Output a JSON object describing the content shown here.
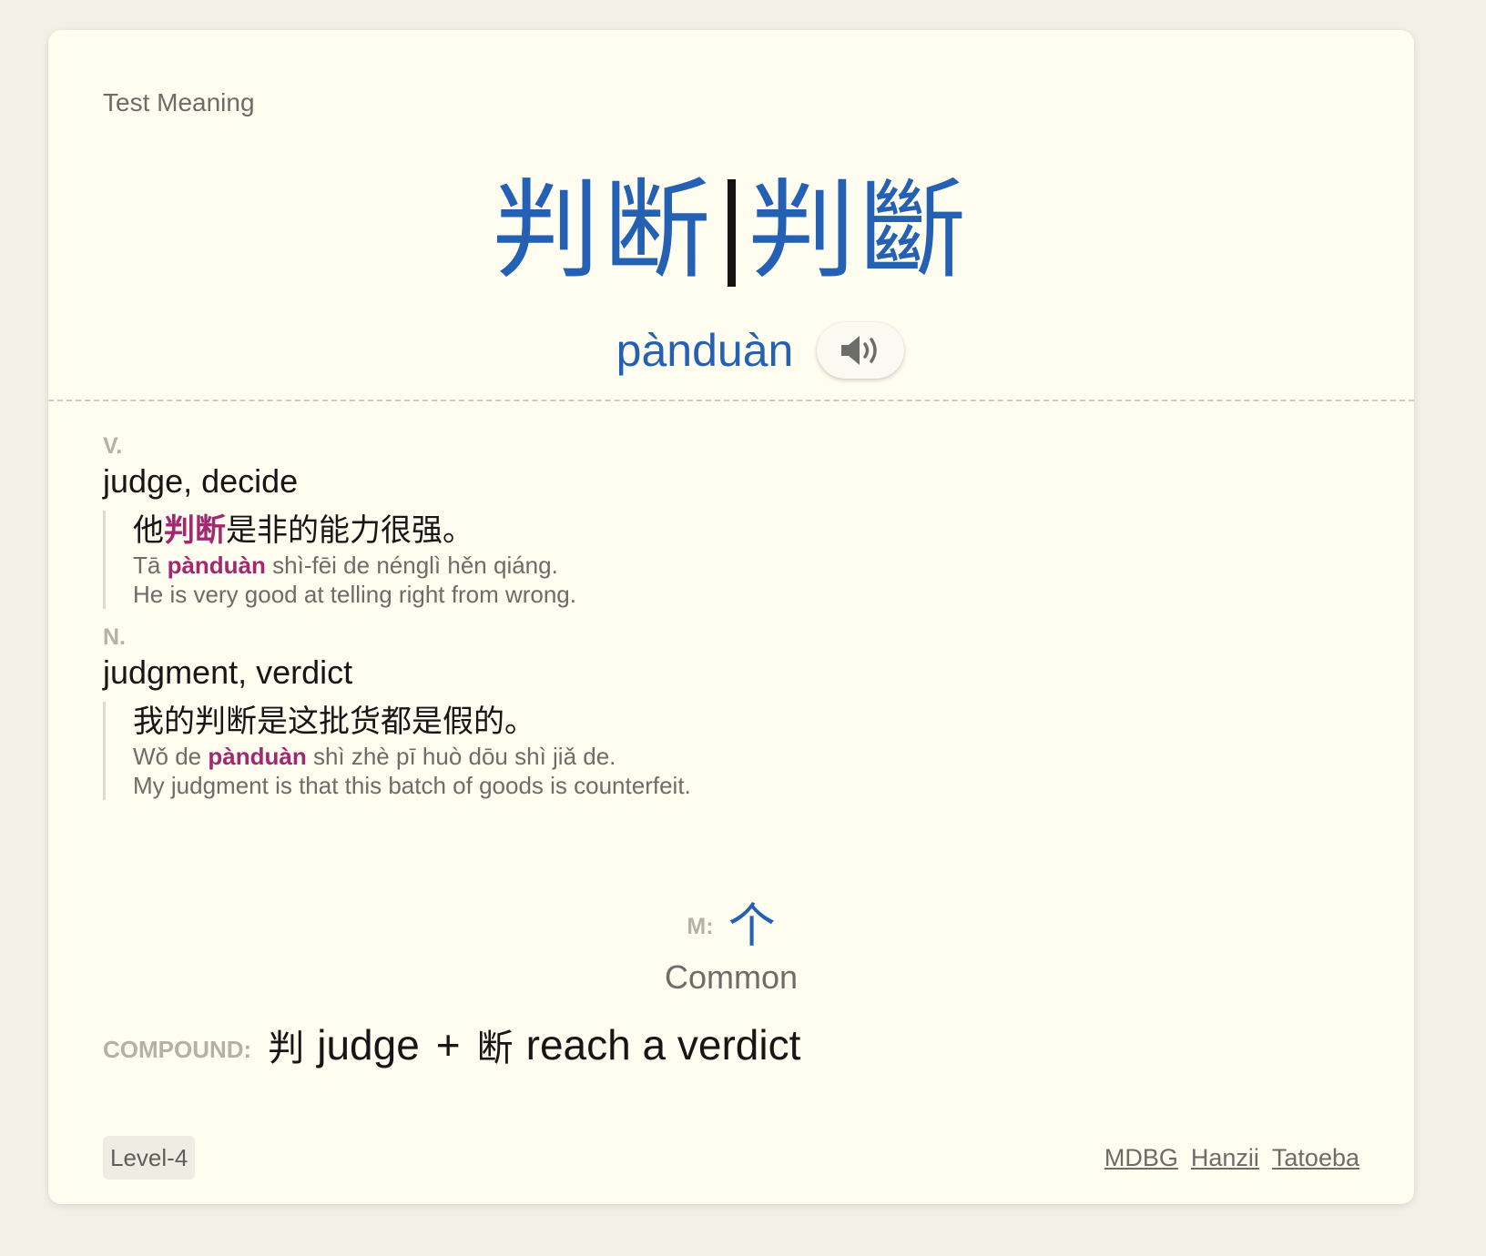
{
  "card": {
    "header_label": "Test Meaning",
    "simplified": "判断",
    "traditional": "判斷",
    "pinyin": "pànduàn",
    "audio_icon": "speaker-icon"
  },
  "definitions": [
    {
      "pos": "V.",
      "meaning": "judge, decide",
      "example": {
        "zh_before": "他",
        "zh_highlight": "判断",
        "zh_after": "是非的能力很强。",
        "py_before": "Tā ",
        "py_highlight": "pànduàn",
        "py_after": " shì-fēi de nénglì hěn qiáng.",
        "en": "He is very good at telling right from wrong."
      }
    },
    {
      "pos": "N.",
      "meaning": "judgment, verdict",
      "example": {
        "zh": "我的判断是这批货都是假的。",
        "py_before": "Wǒ de ",
        "py_highlight": "pànduàn",
        "py_after": " shì zhè pī huò dōu shì jiǎ de.",
        "en": "My judgment is that this batch of goods is counterfeit."
      }
    }
  ],
  "measure_word": {
    "label": "M:",
    "char": "个"
  },
  "frequency": "Common",
  "compound": {
    "label": "COMPOUND:",
    "parts": [
      {
        "char": "判",
        "meaning": "judge"
      },
      {
        "char": "断",
        "meaning": "reach a verdict"
      }
    ],
    "joiner": "+"
  },
  "level": "Level-4",
  "links": [
    "MDBG",
    "Hanzii",
    "Tatoeba"
  ],
  "colors": {
    "accent_blue": "#2460b4",
    "highlight_magenta": "#a3286f",
    "card_bg": "#fefdf0",
    "page_bg": "#f2f0e7"
  }
}
